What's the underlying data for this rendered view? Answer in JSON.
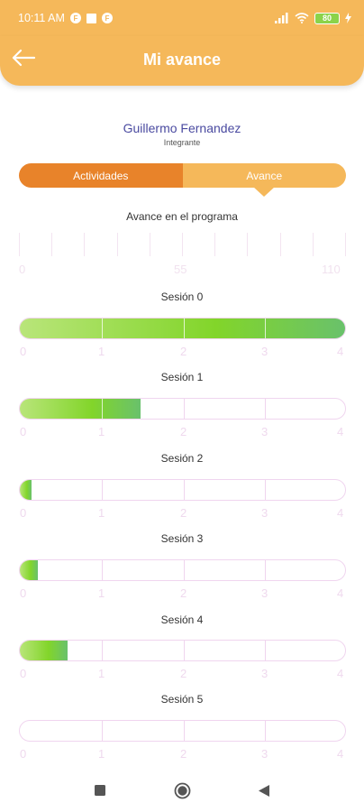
{
  "status_bar": {
    "time": "10:11 AM",
    "icon_letter": "F",
    "battery_level": "80"
  },
  "app_bar": {
    "title": "Mi avance"
  },
  "user": {
    "name": "Guillermo Fernandez",
    "role": "Integrante"
  },
  "tabs": [
    {
      "label": "Actividades"
    },
    {
      "label": "Avance"
    }
  ],
  "program": {
    "label": "Avance en el programa",
    "scale_labels": [
      "0",
      "55",
      "110"
    ],
    "tick_count": 10
  },
  "sessions": [
    {
      "label": "Sesión 0",
      "progress_fraction": 1.0
    },
    {
      "label": "Sesión 1",
      "progress_fraction": 0.37
    },
    {
      "label": "Sesión 2",
      "progress_fraction": 0.035
    },
    {
      "label": "Sesión 3",
      "progress_fraction": 0.055
    },
    {
      "label": "Sesión 4",
      "progress_fraction": 0.145
    },
    {
      "label": "Sesión 5",
      "progress_fraction": 0.0
    }
  ],
  "session_axis": [
    "0",
    "1",
    "2",
    "3",
    "4"
  ],
  "colors": {
    "header": "#f5b85a",
    "tab_active": "#e8832a",
    "tab_inactive": "#f5b85a",
    "name": "#4a4aa0",
    "bar_fill_start": "#b9e57a",
    "bar_fill_mid": "#82d52a",
    "bar_fill_end": "#69c16c",
    "bar_border": "#f0d5ef"
  }
}
